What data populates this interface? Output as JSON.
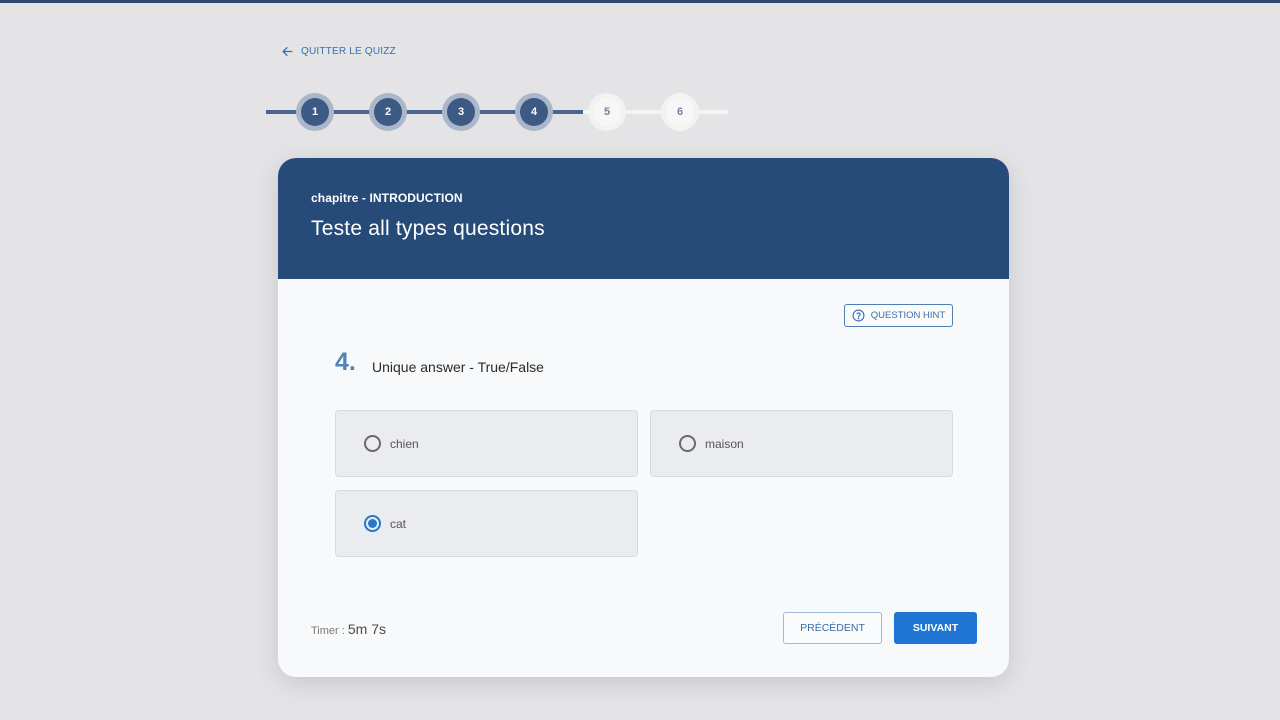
{
  "nav": {
    "quit_label": "QUITTER LE QUIZZ"
  },
  "stepper": {
    "current_step": 4,
    "steps": [
      {
        "label": "1",
        "state": "done"
      },
      {
        "label": "2",
        "state": "done"
      },
      {
        "label": "3",
        "state": "done"
      },
      {
        "label": "4",
        "state": "done"
      },
      {
        "label": "5",
        "state": "todo"
      },
      {
        "label": "6",
        "state": "todo"
      }
    ]
  },
  "header": {
    "chapter": "chapitre - INTRODUCTION",
    "title": "Teste all types questions"
  },
  "hint": {
    "label": "QUESTION HINT",
    "icon": "help-circle-icon"
  },
  "question": {
    "number": "4.",
    "text": "Unique answer - True/False",
    "options": [
      {
        "label": "chien",
        "selected": false
      },
      {
        "label": "maison",
        "selected": false
      },
      {
        "label": "cat",
        "selected": true
      }
    ]
  },
  "footer": {
    "timer_label": "Timer : ",
    "timer_value": "5m 7s",
    "prev_label": "PRÉCÉDENT",
    "next_label": "SUIVANT"
  },
  "colors": {
    "header_bg": "#274b78",
    "accent": "#1f76d2",
    "step_done": "#3c5a84",
    "page_bg": "#e4e4e6"
  }
}
